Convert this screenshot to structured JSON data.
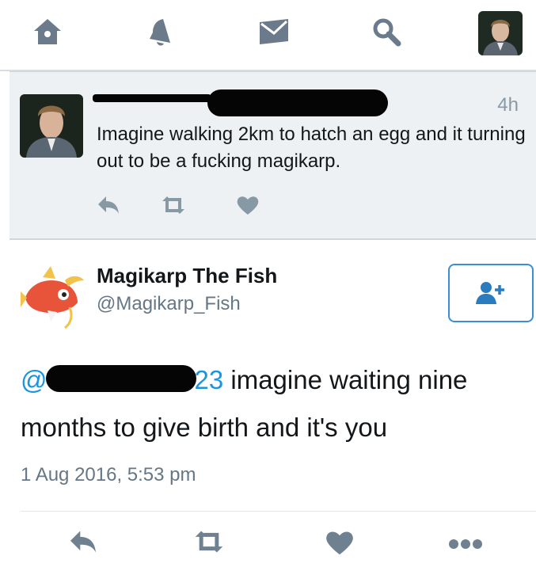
{
  "nav": {
    "items": [
      {
        "name": "home-icon"
      },
      {
        "name": "notifications-icon"
      },
      {
        "name": "messages-icon"
      },
      {
        "name": "search-icon"
      }
    ],
    "profile_avatar": "profile-avatar"
  },
  "parent_tweet": {
    "author_name": "",
    "time": "4h",
    "text": "Imagine walking 2km to hatch an egg and it turning out to be a fucking magikarp."
  },
  "main_tweet": {
    "author_name": "Magikarp The Fish",
    "handle": "@Magikarp_Fish",
    "mention_prefix": "@",
    "mention_suffix": "23",
    "text": " imagine waiting nine months to give birth and it's you",
    "timestamp": "1 Aug 2016, 5:53 pm"
  },
  "colors": {
    "accent": "#1b95e0",
    "icon_grey": "#6b7b8c",
    "parent_bg": "#eef1f4"
  }
}
